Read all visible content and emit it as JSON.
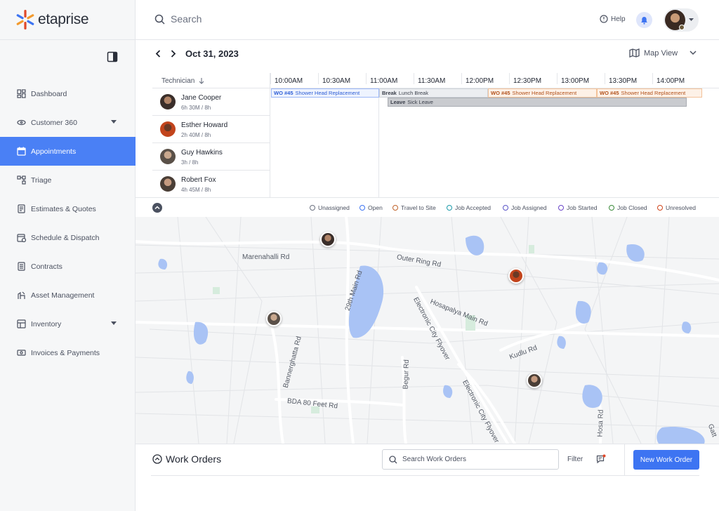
{
  "brand": {
    "name": "etaprise"
  },
  "sidebar": {
    "items": [
      {
        "label": "Dashboard",
        "icon": "dashboard-icon",
        "active": false
      },
      {
        "label": "Customer 360",
        "icon": "customer-icon",
        "active": false,
        "expandable": true
      },
      {
        "label": "Appointments",
        "icon": "calendar-icon",
        "active": true
      },
      {
        "label": "Triage",
        "icon": "triage-icon",
        "active": false
      },
      {
        "label": "Estimates & Quotes",
        "icon": "estimate-icon",
        "active": false
      },
      {
        "label": "Schedule & Dispatch",
        "icon": "schedule-icon",
        "active": false
      },
      {
        "label": "Contracts",
        "icon": "contract-icon",
        "active": false
      },
      {
        "label": "Asset Management",
        "icon": "asset-icon",
        "active": false
      },
      {
        "label": "Inventory",
        "icon": "inventory-icon",
        "active": false,
        "expandable": true
      },
      {
        "label": "Invoices & Payments",
        "icon": "invoice-icon",
        "active": false
      }
    ]
  },
  "header": {
    "search_placeholder": "Search",
    "help_label": "Help"
  },
  "datebar": {
    "date": "Oct 31, 2023",
    "view_label": "Map View"
  },
  "scheduler": {
    "technician_header": "Technician",
    "times": [
      "10:00AM",
      "10:30AM",
      "11:00AM",
      "11:30AM",
      "12:00PM",
      "12:30PM",
      "13:00PM",
      "13:30PM",
      "14:00PM"
    ],
    "technicians": [
      {
        "name": "Jane Cooper",
        "hours": "6h 30M / 8h",
        "avatar_color": "#3a2e2a"
      },
      {
        "name": "Esther Howard",
        "hours": "2h 40M / 8h",
        "avatar_color": "#c2441c"
      },
      {
        "name": "Guy Hawkins",
        "hours": "3h / 8h",
        "avatar_color": "#5a5048"
      },
      {
        "name": "Robert Fox",
        "hours": "4h 45M / 8h",
        "avatar_color": "#4a3e36"
      }
    ],
    "events": [
      {
        "tag": "WO #45",
        "text": "Shower Head Replacement",
        "style": "blue"
      },
      {
        "tag": "Break",
        "text": "Lunch Break",
        "style": "gray"
      },
      {
        "tag": "WO #45",
        "text": "Shower Head Replacement",
        "style": "orange"
      },
      {
        "tag": "WO #45",
        "text": "Shower Head Replacement",
        "style": "orange"
      },
      {
        "tag": "Leave",
        "text": "Sick Leave",
        "style": "grayd"
      }
    ]
  },
  "legend": [
    {
      "label": "Unassigned",
      "color": "#6b7180"
    },
    {
      "label": "Open",
      "color": "#3d74f2"
    },
    {
      "label": "Travel to Site",
      "color": "#c0622a"
    },
    {
      "label": "Job Accepted",
      "color": "#1b9aaa"
    },
    {
      "label": "Job Assigned",
      "color": "#5a55c8"
    },
    {
      "label": "Job Started",
      "color": "#6a45c8"
    },
    {
      "label": "Job Closed",
      "color": "#3a8a3a"
    },
    {
      "label": "Unresolved",
      "color": "#d0451b"
    }
  ],
  "map": {
    "roads": [
      "Marenahalli Rd",
      "Outer Ring Rd",
      "29th Main Rd",
      "Hosapalya Main Rd",
      "Electronic City Flyover",
      "Bannerghatta Rd",
      "Begur Rd",
      "Kudlu Rd",
      "BDA 80 Feet Rd",
      "Electronic City Flyover",
      "Hosa Rd",
      "Gatt"
    ]
  },
  "work_orders": {
    "title": "Work Orders",
    "search_placeholder": "Search Work Orders",
    "filter_label": "Filter",
    "new_button": "New Work Order"
  }
}
